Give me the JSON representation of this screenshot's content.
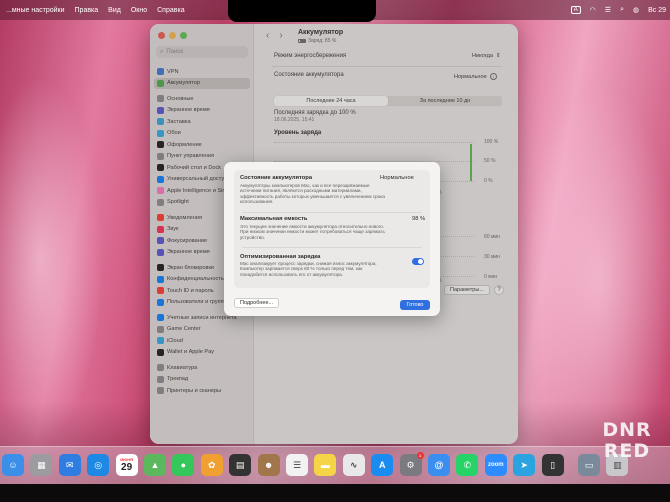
{
  "menubar": {
    "items": [
      "...мные настройки",
      "Правка",
      "Вид",
      "Окно",
      "Справка"
    ],
    "right": {
      "kbd": "A",
      "date": "Вс 29"
    }
  },
  "sidebar": {
    "search_placeholder": "Поиск",
    "items": [
      {
        "label": "VPN",
        "color": "#3a7bd5"
      },
      {
        "label": "Аккумулятор",
        "color": "#4cae4c",
        "active": true
      },
      {
        "label": "Основные",
        "color": "#8e8e93",
        "gap": true
      },
      {
        "label": "Экранное время",
        "color": "#5856d6"
      },
      {
        "label": "Заставка",
        "color": "#34aadc"
      },
      {
        "label": "Обои",
        "color": "#32ade6"
      },
      {
        "label": "Оформление",
        "color": "#1c1c1e"
      },
      {
        "label": "Пункт управления",
        "color": "#8e8e93"
      },
      {
        "label": "Рабочий стол и Dock",
        "color": "#1c1c1e"
      },
      {
        "label": "Универсальный доступ",
        "color": "#0a84ff"
      },
      {
        "label": "Apple Intelligence и Siri",
        "color": "#ff7ac6"
      },
      {
        "label": "Spotlight",
        "color": "#8e8e93"
      },
      {
        "label": "Уведомления",
        "color": "#ff3b30",
        "gap": true
      },
      {
        "label": "Звук",
        "color": "#ff2d55"
      },
      {
        "label": "Фокусирование",
        "color": "#5856d6"
      },
      {
        "label": "Экранное время",
        "color": "#5856d6"
      },
      {
        "label": "Экран блокировки",
        "color": "#1c1c1e",
        "gap": true
      },
      {
        "label": "Конфиденциальность и безопасность",
        "color": "#0a84ff"
      },
      {
        "label": "Touch ID и пароль",
        "color": "#ff3b30"
      },
      {
        "label": "Пользователи и группы",
        "color": "#0a84ff"
      },
      {
        "label": "Учетные записи интернета",
        "color": "#0a84ff",
        "gap": true
      },
      {
        "label": "Game Center",
        "color": "#8e8e93"
      },
      {
        "label": "iCloud",
        "color": "#32ade6"
      },
      {
        "label": "Wallet и Apple Pay",
        "color": "#1c1c1e"
      },
      {
        "label": "Клавиатура",
        "color": "#8e8e93",
        "gap": true
      },
      {
        "label": "Трекпад",
        "color": "#8e8e93"
      },
      {
        "label": "Принтеры и сканеры",
        "color": "#8e8e93"
      }
    ]
  },
  "content": {
    "title": "Аккумулятор",
    "subtitle": "Заряд: 85 %",
    "energy_mode_label": "Режим энергосбережения",
    "energy_mode_value": "Никогда",
    "health_label": "Состояние аккумулятора",
    "health_value": "Нормальное",
    "tabs": [
      "Последние 24 часа",
      "За последние 10 дн"
    ],
    "last_charge": "Последняя зарядка до 100 %",
    "last_charge_date": "18.06.2025, 15:41",
    "level_title": "Уровень заряда",
    "params_button": "Параметры...",
    "help_button": "?"
  },
  "chart_data": {
    "type": "bar",
    "y_ticks_level": [
      "100 %",
      "50 %",
      "0 %"
    ],
    "y_ticks_usage": [
      "60 мин",
      "30 мин",
      "0 мин"
    ],
    "x_ticks": [
      "15",
      "15"
    ]
  },
  "dialog": {
    "health_title": "Состояние аккумулятора",
    "health_value": "Нормальное",
    "health_desc": "Аккумуляторы компьютеров Mac, как и все перезаряжаемые источники питания, являются расходными материалами, эффективность работы которых уменьшается с увеличением срока использования.",
    "capacity_title": "Максимальная емкость",
    "capacity_value": "98 %",
    "capacity_desc": "Это текущее значение емкости аккумулятора относительно нового. При низком значении емкости может потребоваться чаще заряжать устройство.",
    "optimized_title": "Оптимизированная зарядка",
    "optimized_desc": "Mac анализирует процесс зарядки, снижая износ аккумулятора. Компьютер заряжается сверх 80 % только перед тем, как понадобится использовать его от аккумулятора.",
    "optimized_on": true,
    "more_button": "Подробнее...",
    "done_button": "Готово"
  },
  "dock": {
    "calendar_month": "ИЮНЯ",
    "calendar_day": "29",
    "icons": [
      {
        "name": "finder-icon",
        "color": "#3b8fe8",
        "glyph": "☺"
      },
      {
        "name": "launchpad-icon",
        "color": "#9b9ba0",
        "glyph": "▦"
      },
      {
        "name": "mail-icon",
        "color": "#2f7de1",
        "glyph": "✉"
      },
      {
        "name": "safari-icon",
        "color": "#1e88e5",
        "glyph": "◎"
      },
      {
        "name": "calendar-icon",
        "color": "#ffffff",
        "glyph": ""
      },
      {
        "name": "maps-icon",
        "color": "#5cb85c",
        "glyph": "▲"
      },
      {
        "name": "messages-icon",
        "color": "#34c759",
        "glyph": "●"
      },
      {
        "name": "photos-icon",
        "color": "#f0a030",
        "glyph": "✿"
      },
      {
        "name": "calculator-icon",
        "color": "#333333",
        "glyph": "▤"
      },
      {
        "name": "contacts-icon",
        "color": "#a0764a",
        "glyph": "☻"
      },
      {
        "name": "reminders-icon",
        "color": "#f2f2f2",
        "glyph": "☰"
      },
      {
        "name": "notes-icon",
        "color": "#f5d547",
        "glyph": "▬"
      },
      {
        "name": "freeform-icon",
        "color": "#e8e8e8",
        "glyph": "∿"
      },
      {
        "name": "app-store-icon",
        "color": "#1a8cf0",
        "glyph": "A"
      },
      {
        "name": "system-settings-icon",
        "color": "#7a7a80",
        "glyph": "⚙"
      },
      {
        "name": "mail-client-icon",
        "color": "#3a8ef0",
        "glyph": "@"
      },
      {
        "name": "whatsapp-icon",
        "color": "#25d366",
        "glyph": "✆"
      },
      {
        "name": "zoom-icon",
        "color": "#2d8cff",
        "glyph": "zoom"
      },
      {
        "name": "telegram-icon",
        "color": "#2aa3e0",
        "glyph": "➤"
      },
      {
        "name": "iphone-mirroring-icon",
        "color": "#333333",
        "glyph": "▯"
      },
      {
        "name": "preview-icon",
        "color": "#7a8a9a",
        "glyph": "▭"
      },
      {
        "name": "trash-icon",
        "color": "#c8c8cc",
        "glyph": "▥"
      }
    ],
    "settings_badge": "1"
  },
  "watermark": {
    "line1": "DNR",
    "line2": "RED"
  }
}
